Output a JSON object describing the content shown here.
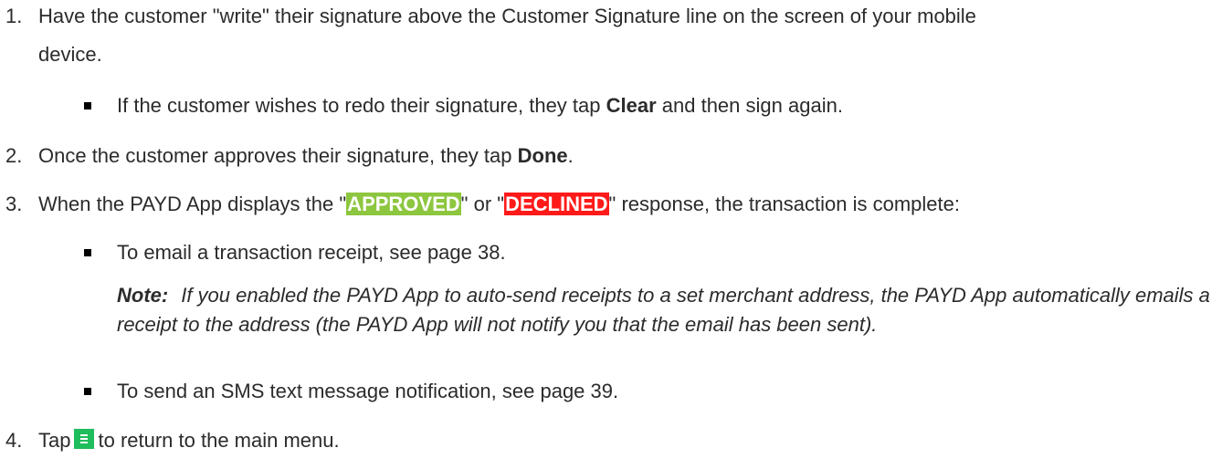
{
  "steps": {
    "s1": {
      "number": "1.",
      "line1": "Have the customer \"write\" their signature above the Customer Signature line on the screen of your mobile",
      "line2": "device.",
      "bullet": {
        "before": "If the customer wishes to redo their signature, they tap ",
        "bold": "Clear",
        "after": " and then sign again."
      }
    },
    "s2": {
      "number": "2.",
      "before": "Once the customer approves their signature, they tap ",
      "bold": "Done",
      "after": "."
    },
    "s3": {
      "number": "3.",
      "before": "When the PAYD App displays the \"",
      "approved": "APPROVED",
      "middle": "\" or \"",
      "declined": "DECLINED",
      "after": "\" response, the transaction is complete:",
      "bullet1": "To email a transaction receipt, see page 38.",
      "note_label": "Note:",
      "note_text": "If you enabled the PAYD App to auto-send receipts to a set merchant address, the PAYD App automatically emails a receipt to the address (the PAYD App will not notify you that the email has been sent).",
      "bullet2": "To send an SMS text message notification, see page 39."
    },
    "s4": {
      "number": "4.",
      "before": "Tap",
      "after": "to return to the main menu.",
      "icon": "menu-icon"
    }
  },
  "colors": {
    "approved": "#8dc63f",
    "declined": "#ff1a1a",
    "menu_icon": "#1fbd5b"
  }
}
